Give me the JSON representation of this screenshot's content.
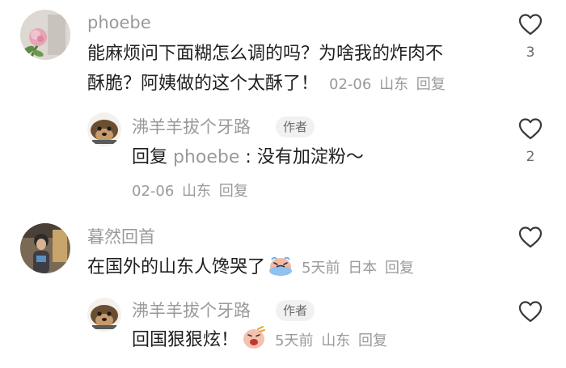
{
  "comments": [
    {
      "user": "phoebe",
      "text_line1": "能麻烦问下面糊怎么调的吗？为啥我的炸肉不",
      "text_line2": "酥脆？阿姨做的这个太酥了！",
      "date": "02-06",
      "location": "山东",
      "reply_label": "回复",
      "likes": "3",
      "avatar_icon": "flower-photo-avatar"
    },
    {
      "user": "沸羊羊拔个牙路",
      "tag": "作者",
      "reply_prefix": "回复",
      "mention": "phoebe",
      "text": ": 没有加淀粉～",
      "date": "02-06",
      "location": "山东",
      "reply_label": "回复",
      "likes": "2",
      "avatar_icon": "cartoon-dog-avatar"
    },
    {
      "user": "暮然回首",
      "text": "在国外的山东人馋哭了",
      "emoji": "crying-emoji",
      "date": "5天前",
      "location": "日本",
      "reply_label": "回复",
      "avatar_icon": "selfie-photo-avatar"
    },
    {
      "user": "沸羊羊拔个牙路",
      "tag": "作者",
      "text": "回国狠狠炫！",
      "emoji": "eating-emoji",
      "date": "5天前",
      "location": "山东",
      "reply_label": "回复",
      "avatar_icon": "cartoon-dog-avatar"
    }
  ],
  "colors": {
    "text": "#1f1f1f",
    "meta": "#9a9a9a",
    "tag_bg": "#f1f1f1"
  }
}
